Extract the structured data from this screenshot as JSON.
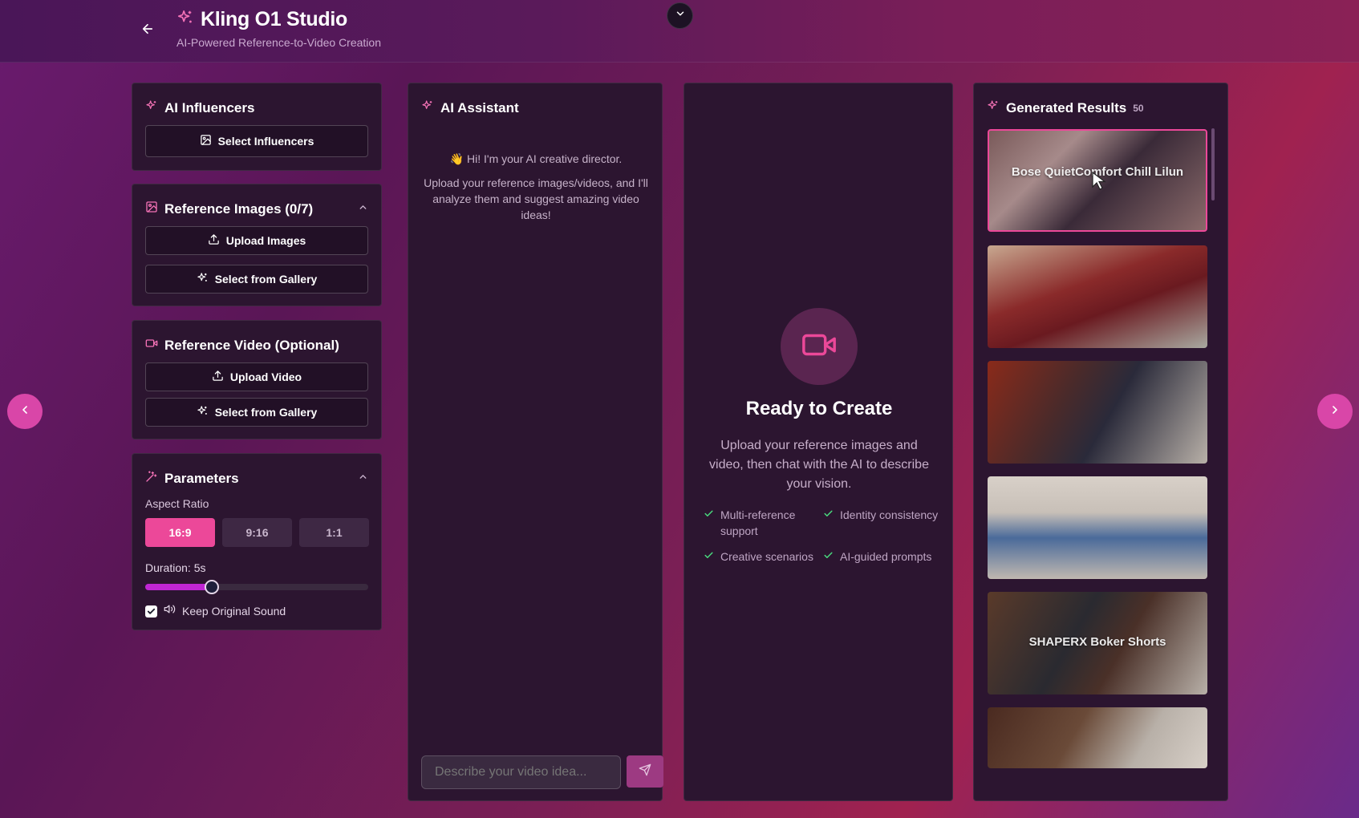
{
  "header": {
    "title": "Kling O1 Studio",
    "subtitle": "AI-Powered Reference-to-Video Creation"
  },
  "influencers": {
    "title": "AI Influencers",
    "select_label": "Select Influencers"
  },
  "reference_images": {
    "title": "Reference Images (0/7)",
    "upload_label": "Upload Images",
    "gallery_label": "Select from Gallery"
  },
  "reference_video": {
    "title": "Reference Video (Optional)",
    "upload_label": "Upload Video",
    "gallery_label": "Select from Gallery"
  },
  "parameters": {
    "title": "Parameters",
    "aspect_ratio_label": "Aspect Ratio",
    "aspect_ratios": [
      "16:9",
      "9:16",
      "1:1"
    ],
    "selected_aspect_ratio": "16:9",
    "duration_label": "Duration: 5s",
    "duration_fraction": 0.3,
    "keep_sound_label": "Keep Original Sound",
    "keep_sound_checked": true
  },
  "assistant": {
    "title": "AI Assistant",
    "greeting": "👋 Hi! I'm your AI creative director.",
    "message": "Upload your reference images/videos, and I'll analyze them and suggest amazing video ideas!",
    "input_placeholder": "Describe your video idea..."
  },
  "preview": {
    "heading": "Ready to Create",
    "description": "Upload your reference images and video, then chat with the AI to describe your vision.",
    "features": [
      "Multi-reference support",
      "Identity consistency",
      "Creative scenarios",
      "AI-guided prompts"
    ]
  },
  "results": {
    "title": "Generated Results",
    "count": "50",
    "items": [
      {
        "label": "Bose QuietComfort Chill Lilun"
      },
      {
        "label": ""
      },
      {
        "label": ""
      },
      {
        "label": ""
      },
      {
        "label": "SHAPERX Boker Shorts"
      },
      {
        "label": ""
      }
    ]
  },
  "colors": {
    "accent": "#ec4899",
    "panel": "#2c1530"
  }
}
